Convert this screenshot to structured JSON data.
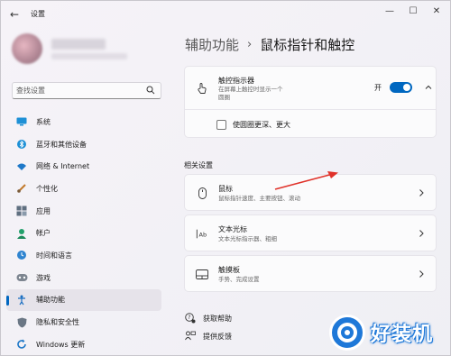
{
  "window": {
    "app_title": "设置",
    "back_glyph": "←",
    "minimize_glyph": "—",
    "maximize_glyph": "☐",
    "close_glyph": "✕"
  },
  "search": {
    "placeholder": "查找设置"
  },
  "sidebar": {
    "items": [
      {
        "label": "系统",
        "icon": "system-icon",
        "active": false
      },
      {
        "label": "蓝牙和其他设备",
        "icon": "bluetooth-icon",
        "active": false
      },
      {
        "label": "网络 & Internet",
        "icon": "wifi-icon",
        "active": false
      },
      {
        "label": "个性化",
        "icon": "brush-icon",
        "active": false
      },
      {
        "label": "应用",
        "icon": "apps-icon",
        "active": false
      },
      {
        "label": "帐户",
        "icon": "person-icon",
        "active": false
      },
      {
        "label": "时间和语言",
        "icon": "globe-clock-icon",
        "active": false
      },
      {
        "label": "游戏",
        "icon": "gamepad-icon",
        "active": false
      },
      {
        "label": "辅助功能",
        "icon": "accessibility-icon",
        "active": true
      },
      {
        "label": "隐私和安全性",
        "icon": "shield-icon",
        "active": false
      },
      {
        "label": "Windows 更新",
        "icon": "update-icon",
        "active": false
      }
    ]
  },
  "breadcrumb": {
    "parent": "辅助功能",
    "separator": "›",
    "current": "鼠标指针和触控"
  },
  "touch_indicator": {
    "title": "触控指示器",
    "description_line1": "在屏幕上触控时显示一个",
    "description_line2": "圆圈",
    "toggle_label": "开",
    "toggle_on": true,
    "checkbox_label": "使圆圈更深、更大",
    "checkbox_checked": false
  },
  "related": {
    "section_title": "相关设置",
    "items": [
      {
        "title": "鼠标",
        "description": "鼠标指针速度、主要按钮、滚动",
        "icon": "mouse-icon"
      },
      {
        "title": "文本光标",
        "description": "文本光标指示器、粗细",
        "icon": "text-cursor-icon"
      },
      {
        "title": "触摸板",
        "description": "手势、完成设置",
        "icon": "touchpad-icon"
      }
    ]
  },
  "links": {
    "help": "获取帮助",
    "feedback": "提供反馈"
  },
  "watermark": {
    "text": "好装机"
  },
  "colors": {
    "accent": "#0067c0",
    "annotation_arrow": "#e0322a"
  }
}
